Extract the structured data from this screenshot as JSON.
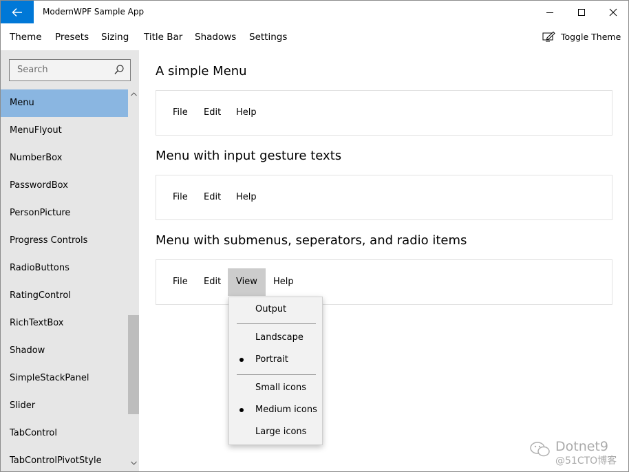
{
  "window": {
    "title": "ModernWPF Sample App"
  },
  "menubar": {
    "items": [
      "Theme",
      "Presets",
      "Sizing",
      "Title Bar",
      "Shadows",
      "Settings"
    ],
    "toggle_theme": "Toggle Theme"
  },
  "sidebar": {
    "search_placeholder": "Search",
    "items": [
      "Menu",
      "MenuFlyout",
      "NumberBox",
      "PasswordBox",
      "PersonPicture",
      "Progress Controls",
      "RadioButtons",
      "RatingControl",
      "RichTextBox",
      "Shadow",
      "SimpleStackPanel",
      "Slider",
      "TabControl",
      "TabControlPivotStyle"
    ],
    "selected": "Menu"
  },
  "content": {
    "sections": [
      {
        "title": "A simple Menu",
        "menu": [
          "File",
          "Edit",
          "Help"
        ]
      },
      {
        "title": "Menu with input gesture texts",
        "menu": [
          "File",
          "Edit",
          "Help"
        ]
      },
      {
        "title": "Menu with submenus, seperators, and radio items",
        "menu": [
          "File",
          "Edit",
          "View",
          "Help"
        ],
        "open": "View"
      }
    ],
    "view_dropdown": {
      "items": [
        "Output",
        "Landscape",
        "Portrait",
        "Small icons",
        "Medium icons",
        "Large icons"
      ],
      "checked": [
        "Portrait",
        "Medium icons"
      ]
    }
  },
  "watermark": {
    "line1": "Dotnet9",
    "line2": "@51CTO博客"
  },
  "colors": {
    "accent": "#0078d7",
    "selected_nav": "#8ab6e1",
    "sidebar_bg": "#e6e6e6",
    "open_menu_item": "#cccccc"
  }
}
